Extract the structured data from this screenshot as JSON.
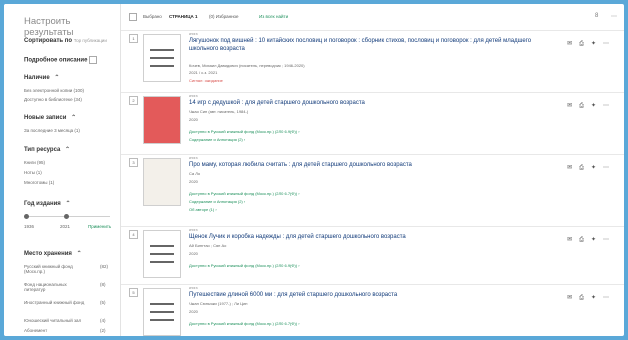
{
  "sidebar": {
    "title": "Настроить результаты",
    "sort_label": "Сортировать по",
    "sort_value": "Тор публикации",
    "detailed_label": "Подробное описание",
    "availability_label": "Наличие",
    "availability_items": [
      "Без электронной копии (100)",
      "Доступно в библиотеке (34)"
    ],
    "new_label": "Новые записи",
    "new_items": [
      "За последние 3 месяца (1)"
    ],
    "type_label": "Тип ресурса",
    "type_items": [
      "Книги (95)",
      "Ноты (1)",
      "Многотомы (1)"
    ],
    "year_label": "Год издания",
    "year_from": "1936",
    "year_to": "2021",
    "apply_label": "Применить",
    "location_label": "Место хранения",
    "location_items": [
      {
        "name": "Русский книжный фонд (Моск.пр.)",
        "count": "(82)"
      },
      {
        "name": "Фонд национальных литератур",
        "count": "(8)"
      },
      {
        "name": "Иностранный книжный фонд",
        "count": "(5)"
      },
      {
        "name": "Юношеский читальный зал",
        "count": "(4)"
      },
      {
        "name": "Абонемент",
        "count": "(2)"
      }
    ]
  },
  "topbar": {
    "select_label": "Выбрано",
    "page_label": "СТРАНИЦА 1",
    "favorites_label": "(0) Избранное",
    "save_label": "Из всех найти",
    "count": "8"
  },
  "results": [
    {
      "num": "1",
      "type": "книга",
      "title": "Лягушонок под вишней : 10 китайских пословиц и поговорок : сборник стихов, пословиц и поговорок : для детей младшего школьного возраста",
      "author": "Кочев, Михаил Давидович (писатель, переводчик ; 1946-2020)",
      "year": "2021 / с.з. 2021",
      "avail": "Сигнал: ожидание",
      "content": "",
      "cover": "plain"
    },
    {
      "num": "2",
      "type": "книга",
      "title": "14 игр с дедушкой : для детей старшего дошкольного возраста",
      "author": "Чжао Син (авт. писатель, 1984-)",
      "year": "2020",
      "avail": "Доступно в Русский книжный фонд (Моск.пр.)  (2Л0 6.9(Ф)) ›",
      "content": "Содержание и Аннотация (2) ›",
      "cover": "red"
    },
    {
      "num": "3",
      "type": "книга",
      "title": "Про маму, которая любила считать : для детей старшего дошкольного возраста",
      "author": "Са Ло",
      "year": "2020",
      "avail": "Доступно в Русский книжный фонд (Моск.пр.)  (2Л0 6.7(Ф)) ›",
      "content": "Содержание и Аннотация (2) ›",
      "extra": "Об авторе (1) ›",
      "cover": "photo"
    },
    {
      "num": "4",
      "type": "книга",
      "title": "Щенок Лучик и коробка надежды : для детей старшего дошкольного возраста",
      "author": "Ай Бингтао  ;  Сян Ао",
      "year": "2020",
      "avail": "Доступно в Русский книжный фонд (Моск.пр.)  (2Л0 6.9(Ф)) ›",
      "content": "",
      "cover": "plain"
    },
    {
      "num": "5",
      "type": "книга",
      "title": "Путешествие длиной 6000 ми : для детей старшего дошкольного возраста",
      "author": "Чжан Сюньчжи (1977-)  ;  Ли Цин",
      "year": "2020",
      "avail": "Доступно в Русский книжный фонд (Моск.пр.)  (2Л0 6.7(Ф)) ›",
      "content": "",
      "cover": "plain"
    }
  ]
}
